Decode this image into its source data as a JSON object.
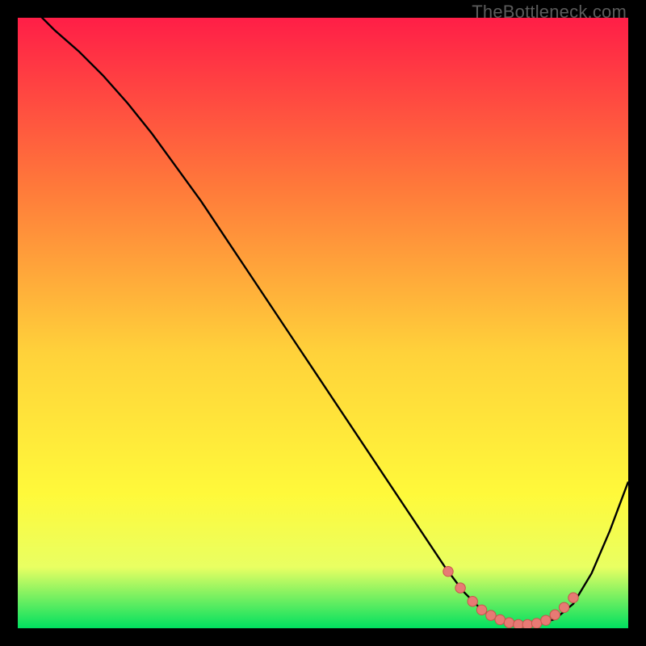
{
  "watermark": "TheBottleneck.com",
  "colors": {
    "gradient_top": "#ff1e47",
    "gradient_mid1": "#ff7a3a",
    "gradient_mid2": "#ffd23a",
    "gradient_mid3": "#fff93a",
    "gradient_mid4": "#e9ff62",
    "gradient_bottom": "#00e060",
    "curve": "#000000",
    "marker_fill": "#e77a74",
    "marker_stroke": "#c9534c"
  },
  "chart_data": {
    "type": "line",
    "title": "",
    "xlabel": "",
    "ylabel": "",
    "xlim": [
      0,
      100
    ],
    "ylim": [
      0,
      100
    ],
    "series": [
      {
        "name": "bottleneck-curve",
        "x": [
          0,
          3,
          6,
          10,
          14,
          18,
          22,
          26,
          30,
          34,
          38,
          42,
          46,
          50,
          54,
          58,
          62,
          66,
          70,
          73,
          76,
          79,
          82,
          85,
          88,
          91,
          94,
          97,
          100
        ],
        "y": [
          104,
          101,
          98,
          94.5,
          90.5,
          86,
          81,
          75.5,
          70,
          64,
          58,
          52,
          46,
          40,
          34,
          28,
          22,
          16,
          10,
          6,
          3,
          1.3,
          0.6,
          0.6,
          1.5,
          4,
          9,
          16,
          24
        ]
      }
    ],
    "markers": {
      "name": "optimal-range",
      "x": [
        70.5,
        72.5,
        74.5,
        76,
        77.5,
        79,
        80.5,
        82,
        83.5,
        85,
        86.5,
        88,
        89.5,
        91
      ],
      "y": [
        9.3,
        6.6,
        4.4,
        3.0,
        2.1,
        1.4,
        0.9,
        0.6,
        0.6,
        0.8,
        1.3,
        2.2,
        3.4,
        5.0
      ]
    }
  }
}
